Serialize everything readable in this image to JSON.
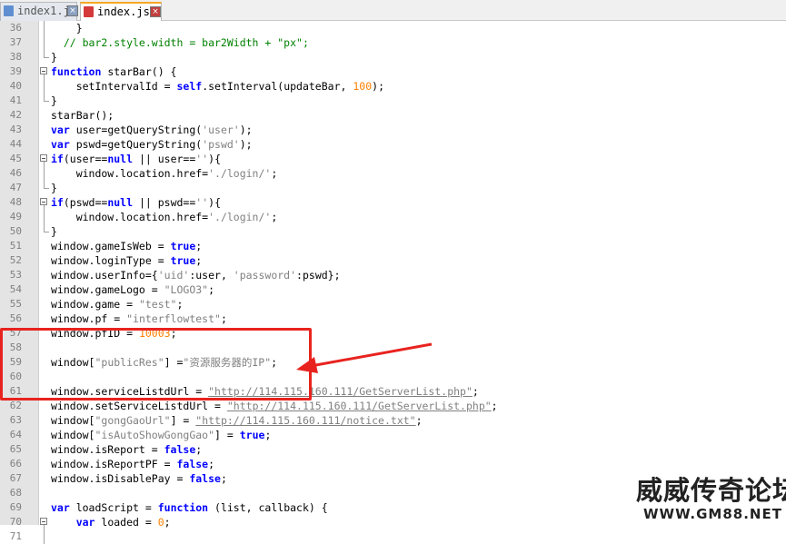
{
  "tabs": [
    {
      "label": "index1.js",
      "active": false
    },
    {
      "label": "index.js",
      "active": true
    }
  ],
  "editor": {
    "lines": [
      {
        "n": "36",
        "fold": "v"
      },
      {
        "n": "37",
        "fold": "v"
      },
      {
        "n": "38",
        "fold": "end"
      },
      {
        "n": "39",
        "fold": "box"
      },
      {
        "n": "40",
        "fold": "v"
      },
      {
        "n": "41",
        "fold": "end"
      },
      {
        "n": "42",
        "fold": ""
      },
      {
        "n": "43",
        "fold": ""
      },
      {
        "n": "44",
        "fold": ""
      },
      {
        "n": "45",
        "fold": "box"
      },
      {
        "n": "46",
        "fold": "v"
      },
      {
        "n": "47",
        "fold": "end"
      },
      {
        "n": "48",
        "fold": "box"
      },
      {
        "n": "49",
        "fold": "v"
      },
      {
        "n": "50",
        "fold": "end"
      },
      {
        "n": "51",
        "fold": ""
      },
      {
        "n": "52",
        "fold": ""
      },
      {
        "n": "53",
        "fold": ""
      },
      {
        "n": "54",
        "fold": ""
      },
      {
        "n": "55",
        "fold": ""
      },
      {
        "n": "56",
        "fold": ""
      },
      {
        "n": "57",
        "fold": ""
      },
      {
        "n": "58",
        "fold": ""
      },
      {
        "n": "59",
        "fold": ""
      },
      {
        "n": "60",
        "fold": ""
      },
      {
        "n": "61",
        "fold": ""
      },
      {
        "n": "62",
        "fold": ""
      },
      {
        "n": "63",
        "fold": ""
      },
      {
        "n": "64",
        "fold": ""
      },
      {
        "n": "65",
        "fold": ""
      },
      {
        "n": "66",
        "fold": ""
      },
      {
        "n": "67",
        "fold": ""
      },
      {
        "n": "68",
        "fold": ""
      },
      {
        "n": "69",
        "fold": ""
      },
      {
        "n": "70",
        "fold": "box"
      },
      {
        "n": "71",
        "fold": "v"
      }
    ],
    "code": {
      "l36_brace": "    }",
      "l37_comment": "  // bar2.style.width = bar2Width + \"px\";",
      "l38": "}",
      "l39_kw": "function",
      "l39_rest": " starBar() {",
      "l40_a": "    setIntervalId = ",
      "l40_self": "self",
      "l40_b": ".setInterval(updateBar, ",
      "l40_num": "100",
      "l40_c": ");",
      "l41": "}",
      "l42": "starBar();",
      "l43_kw": "var",
      "l43_a": " user=getQueryString(",
      "l43_str": "'user'",
      "l43_b": ");",
      "l44_kw": "var",
      "l44_a": " pswd=getQueryString(",
      "l44_str": "'pswd'",
      "l44_b": ");",
      "l45_kw": "if",
      "l45_a": "(user==",
      "l45_null": "null",
      "l45_b": " || user==",
      "l45_str": "''",
      "l45_c": "){",
      "l46_a": "    window.location.href=",
      "l46_str": "'./login/'",
      "l46_b": ";",
      "l47": "}",
      "l48_kw": "if",
      "l48_a": "(pswd==",
      "l48_null": "null",
      "l48_b": " || pswd==",
      "l48_str": "''",
      "l48_c": "){",
      "l49_a": "    window.location.href=",
      "l49_str": "'./login/'",
      "l49_b": ";",
      "l50": "}",
      "l51_a": "window.gameIsWeb = ",
      "l51_v": "true",
      "l51_b": ";",
      "l52_a": "window.loginType = ",
      "l52_v": "true",
      "l52_b": ";",
      "l53_a": "window.userInfo={",
      "l53_s1": "'uid'",
      "l53_b": ":user, ",
      "l53_s2": "'password'",
      "l53_c": ":pswd};",
      "l54_a": "window.gameLogo = ",
      "l54_s": "\"LOGO3\"",
      "l54_b": ";",
      "l55_a": "window.game = ",
      "l55_s": "\"test\"",
      "l55_b": ";",
      "l56_a": "window.pf = ",
      "l56_s": "\"interflowtest\"",
      "l56_b": ";",
      "l57_a": "window.pfID = ",
      "l57_n": "10003",
      "l57_b": ";",
      "l59_a": "window[",
      "l59_s": "\"publicRes\"",
      "l59_b": "] =",
      "l59_s2": "\"资源服务器的IP\"",
      "l59_c": ";",
      "l61_a": "window.serviceListdUrl = ",
      "l61_u": "\"http://114.115.160.111/GetServerList.php\"",
      "l61_b": ";",
      "l62_a": "window.setServiceListdUrl = ",
      "l62_u": "\"http://114.115.160.111/GetServerList.php\"",
      "l62_b": ";",
      "l63_a": "window[",
      "l63_s": "\"gongGaoUrl\"",
      "l63_b": "] = ",
      "l63_u": "\"http://114.115.160.111/notice.txt\"",
      "l63_c": ";",
      "l64_a": "window[",
      "l64_s": "\"isAutoShowGongGao\"",
      "l64_b": "] = ",
      "l64_v": "true",
      "l64_c": ";",
      "l65_a": "window.isReport = ",
      "l65_v": "false",
      "l65_b": ";",
      "l66_a": "window.isReportPF = ",
      "l66_v": "false",
      "l66_b": ";",
      "l67_a": "window.isDisablePay = ",
      "l67_v": "false",
      "l67_b": ";",
      "l70_kw": "var",
      "l70_a": " loadScript = ",
      "l70_fn": "function",
      "l70_b": " (list, callback) {",
      "l71_pad": "    ",
      "l71_kw": "var",
      "l71_a": " loaded = ",
      "l71_n": "0",
      "l71_b": ";"
    }
  },
  "annotation": {
    "color": "#e8231f"
  },
  "watermark": {
    "title": "威威传奇论坛",
    "url": "WWW.GM88.NET"
  }
}
